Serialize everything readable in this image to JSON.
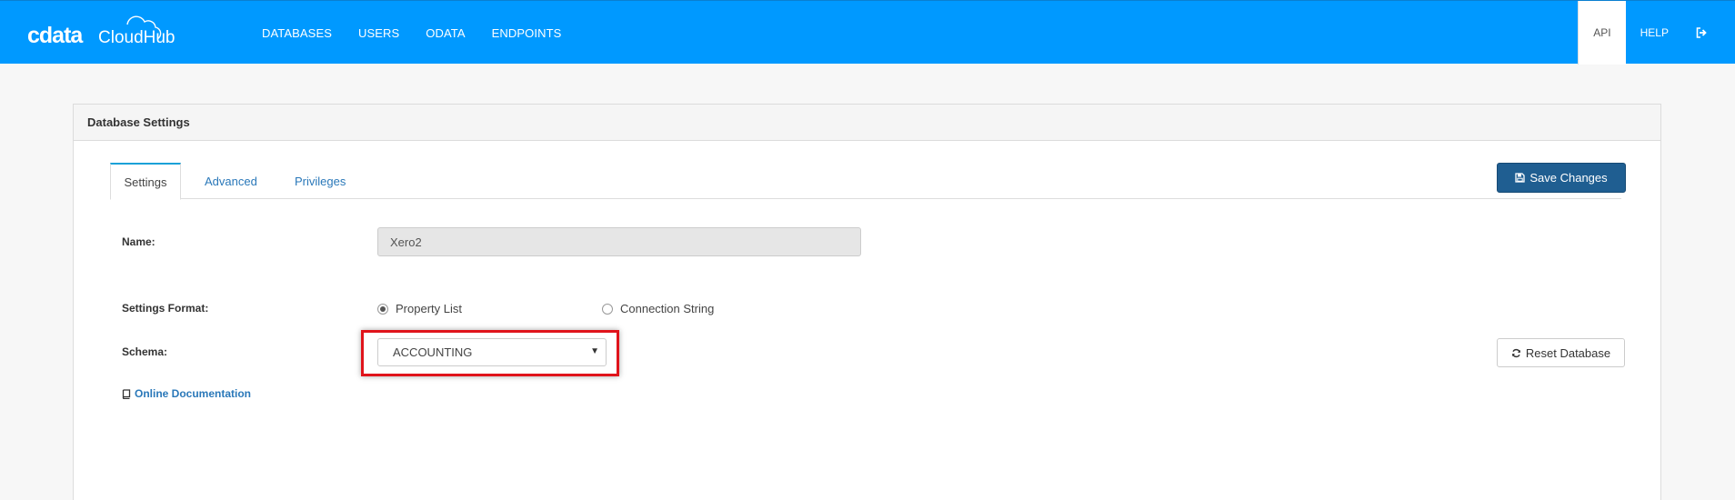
{
  "brand": {
    "logo_text": "cdata",
    "logo_sub": "CloudHub"
  },
  "nav": {
    "items": [
      "DATABASES",
      "USERS",
      "ODATA",
      "ENDPOINTS"
    ]
  },
  "nav_right": {
    "api": "API",
    "help": "HELP"
  },
  "panel": {
    "title": "Database Settings",
    "tabs": [
      {
        "label": "Settings",
        "active": true
      },
      {
        "label": "Advanced",
        "active": false
      },
      {
        "label": "Privileges",
        "active": false
      }
    ],
    "save_label": "Save Changes",
    "fields": {
      "name_label": "Name:",
      "name_value": "Xero2",
      "format_label": "Settings Format:",
      "format_options": [
        "Property List",
        "Connection String"
      ],
      "format_selected": "Property List",
      "schema_label": "Schema:",
      "schema_value": "ACCOUNTING"
    },
    "reset_label": "Reset Database",
    "doc_link": "Online Documentation"
  },
  "colors": {
    "nav": "#0099ff",
    "primary_button": "#1f5e91",
    "link": "#2a78b9",
    "highlight": "#e0141b"
  }
}
